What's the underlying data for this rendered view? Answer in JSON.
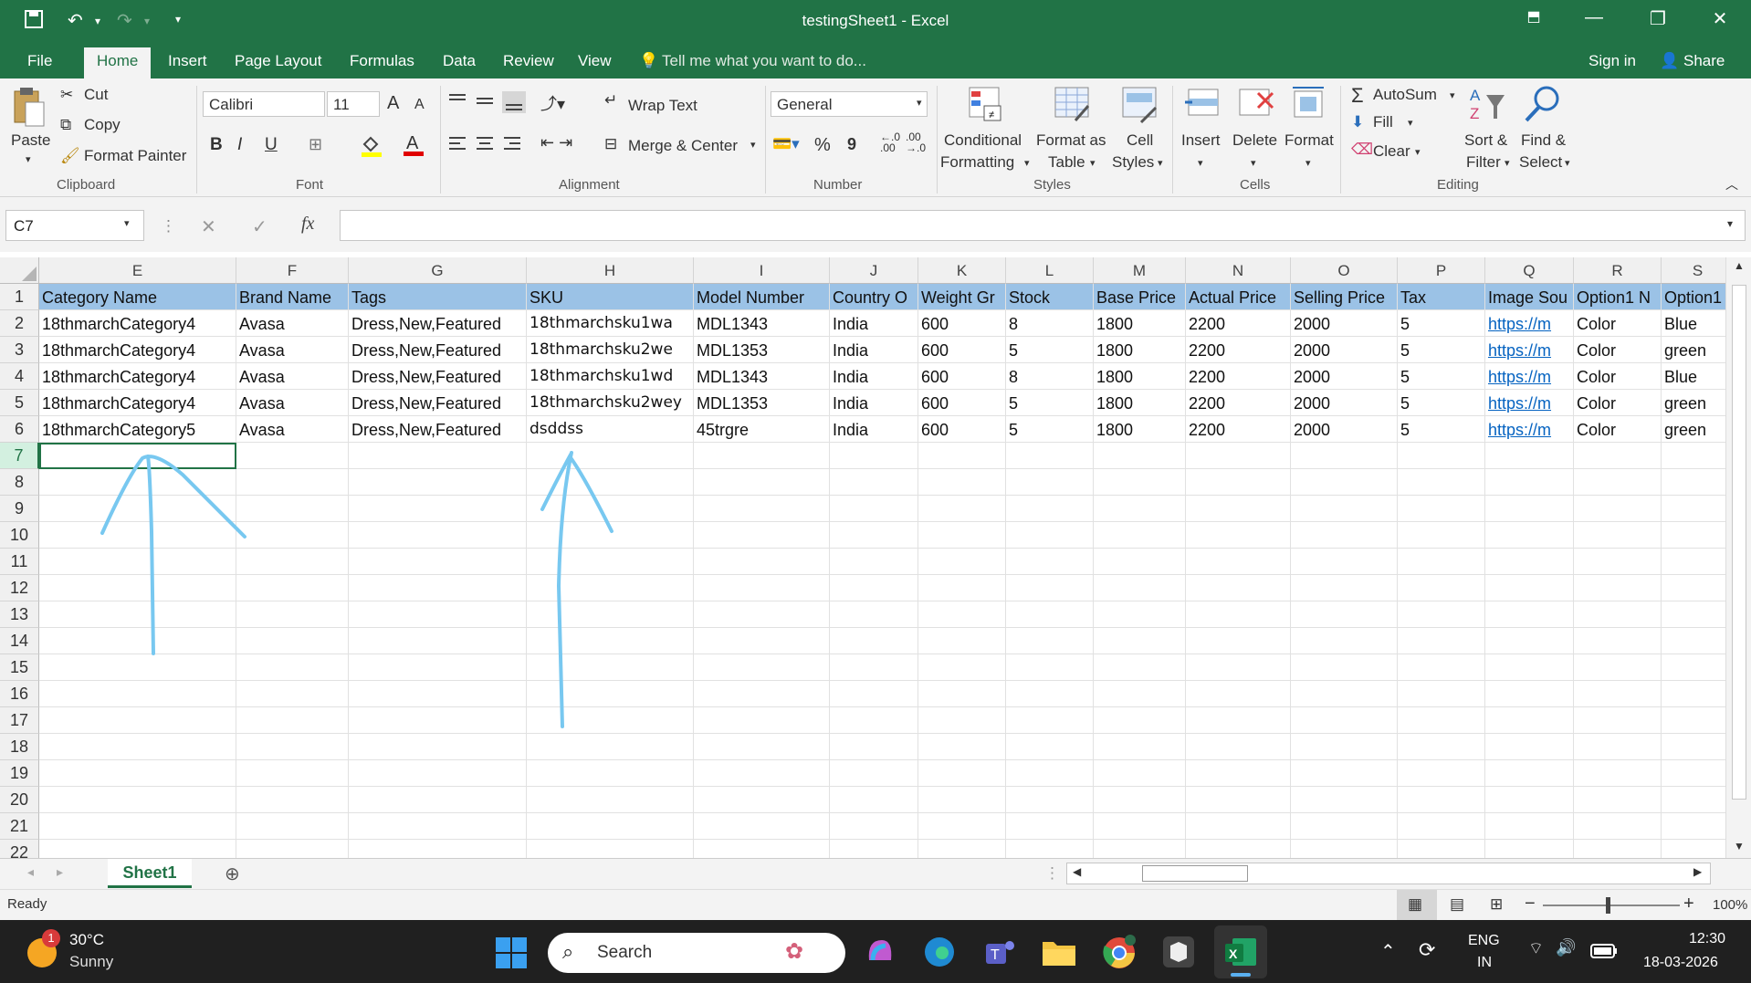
{
  "window": {
    "title": "testingSheet1 - Excel"
  },
  "tabs": [
    "File",
    "Home",
    "Insert",
    "Page Layout",
    "Formulas",
    "Data",
    "Review",
    "View"
  ],
  "tell_me": "Tell me what you want to do...",
  "account": {
    "sign_in": "Sign in",
    "share": "Share"
  },
  "ribbon": {
    "clipboard": {
      "paste": "Paste",
      "cut": "Cut",
      "copy": "Copy",
      "format_painter": "Format Painter",
      "label": "Clipboard"
    },
    "font": {
      "name": "Calibri",
      "size": "11",
      "bold": "B",
      "italic": "I",
      "underline": "U",
      "label": "Font"
    },
    "alignment": {
      "wrap_text": "Wrap Text",
      "merge_center": "Merge & Center",
      "label": "Alignment"
    },
    "number": {
      "format": "General",
      "percent": "%",
      "comma": "9",
      "label": "Number"
    },
    "styles": {
      "conditional": "Conditional",
      "formatting": "Formatting",
      "format_as": "Format as",
      "table": "Table",
      "cell": "Cell",
      "cell_styles": "Styles",
      "label": "Styles"
    },
    "cells": {
      "insert": "Insert",
      "delete": "Delete",
      "format": "Format",
      "label": "Cells"
    },
    "editing": {
      "autosum": "AutoSum",
      "fill": "Fill",
      "clear": "Clear",
      "sort": "Sort &",
      "filter": "Filter",
      "find": "Find &",
      "select": "Select",
      "label": "Editing"
    }
  },
  "formula_bar": {
    "name_box": "C7",
    "fx": "fx",
    "content": ""
  },
  "columns": [
    "E",
    "F",
    "G",
    "H",
    "I",
    "J",
    "K",
    "L",
    "M",
    "N",
    "O",
    "P",
    "Q",
    "R",
    "S"
  ],
  "rows": [
    "1",
    "2",
    "3",
    "4",
    "5",
    "6",
    "7",
    "8",
    "9",
    "10",
    "11",
    "12",
    "13",
    "14",
    "15",
    "16",
    "17",
    "18",
    "19",
    "20",
    "21",
    "22"
  ],
  "header_row": [
    "Category Name",
    "Brand Name",
    "Tags",
    "SKU",
    "Model Number",
    "Country O",
    "Weight Gr",
    "Stock",
    "Base Price",
    "Actual Price",
    "Selling Price",
    "Tax",
    "Image Sou",
    "Option1 N",
    "Option1"
  ],
  "data_rows": [
    [
      "18thmarchCategory4",
      "Avasa",
      "Dress,New,Featured",
      "18thmarchsku1wa",
      "MDL1343",
      "India",
      "600",
      "8",
      "1800",
      "2200",
      "2000",
      "5",
      "https://m",
      "Color",
      "Blue"
    ],
    [
      "18thmarchCategory4",
      "Avasa",
      "Dress,New,Featured",
      "18thmarchsku2we",
      "MDL1353",
      "India",
      "600",
      "5",
      "1800",
      "2200",
      "2000",
      "5",
      "https://m",
      "Color",
      "green"
    ],
    [
      "18thmarchCategory4",
      "Avasa",
      "Dress,New,Featured",
      "18thmarchsku1wd",
      "MDL1343",
      "India",
      "600",
      "8",
      "1800",
      "2200",
      "2000",
      "5",
      "https://m",
      "Color",
      "Blue"
    ],
    [
      "18thmarchCategory4",
      "Avasa",
      "Dress,New,Featured",
      "18thmarchsku2wey",
      "MDL1353",
      "India",
      "600",
      "5",
      "1800",
      "2200",
      "2000",
      "5",
      "https://m",
      "Color",
      "green"
    ],
    [
      "18thmarchCategory5",
      "Avasa",
      "Dress,New,Featured",
      "dsddss",
      "45trgre",
      "India",
      "600",
      "5",
      "1800",
      "2200",
      "2000",
      "5",
      "https://m",
      "Color",
      "green"
    ]
  ],
  "sheet_tabs": [
    "Sheet1"
  ],
  "status": {
    "ready": "Ready",
    "zoom": "100%"
  },
  "taskbar": {
    "weather_temp": "30°C",
    "weather_desc": "Sunny",
    "weather_badge": "1",
    "search": "Search",
    "lang1": "ENG",
    "lang2": "IN",
    "time": "12:30",
    "date": "18-03-2026"
  },
  "colors": {
    "accent": "#217346",
    "header_fill": "#9bc2e6",
    "annotation": "#78c8f0"
  }
}
